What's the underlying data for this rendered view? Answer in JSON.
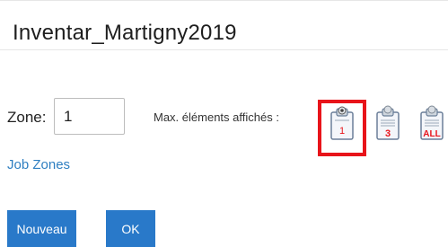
{
  "header": {
    "title": "Inventar_Martigny2019"
  },
  "zone": {
    "label": "Zone:",
    "value": "1"
  },
  "max_display": {
    "label": "Max. éléments affichés :",
    "options": [
      {
        "label": "1",
        "icon": "clipboard-1-icon",
        "color": "#e8141a"
      },
      {
        "label": "3",
        "icon": "clipboard-3-icon",
        "color": "#e8141a"
      },
      {
        "label": "ALL",
        "icon": "clipboard-all-icon",
        "color": "#e8141a"
      }
    ],
    "selected": "1",
    "highlight_color": "#e8141a"
  },
  "links": {
    "job_zones": "Job Zones"
  },
  "buttons": {
    "new_label": "Nouveau",
    "ok_label": "OK",
    "color": "#2979c9"
  }
}
